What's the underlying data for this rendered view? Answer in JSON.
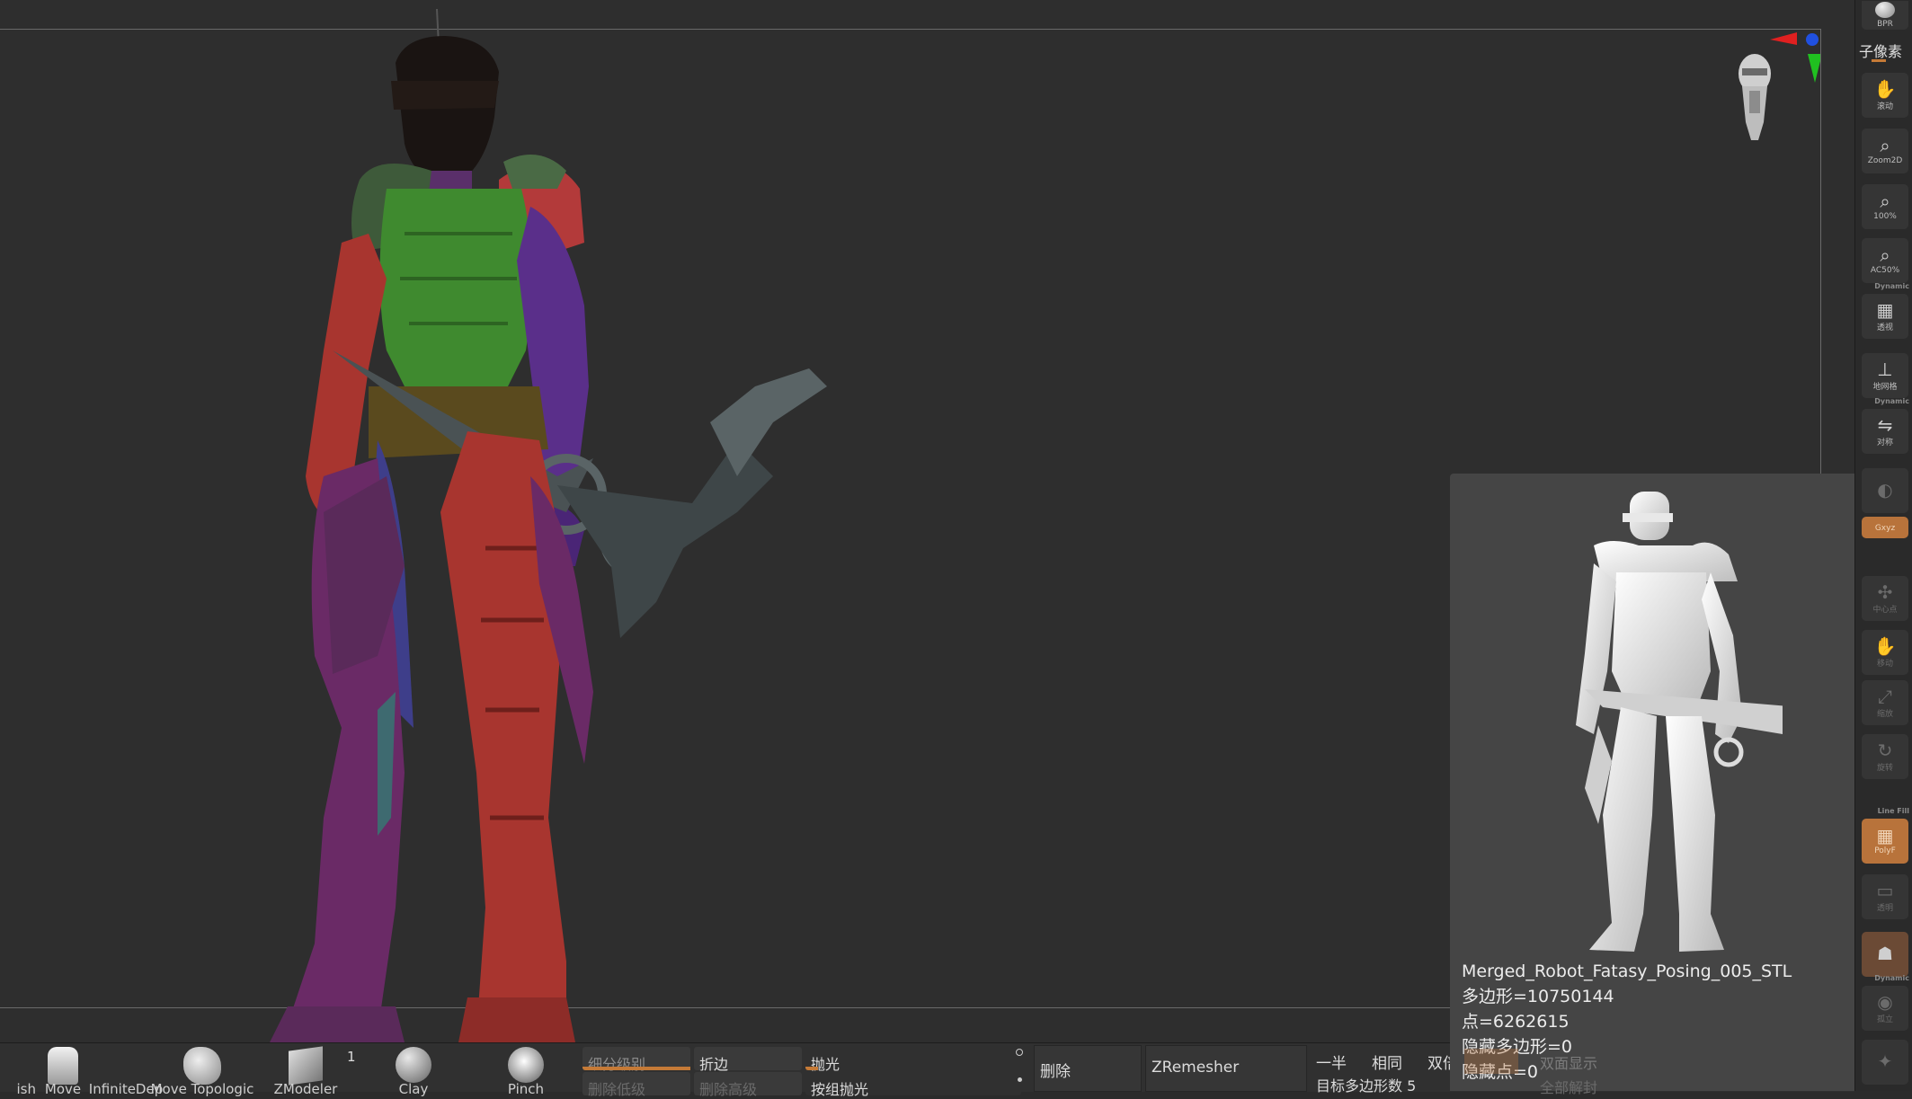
{
  "right_shelf": {
    "bpr": "BPR",
    "subpixel": "子像素",
    "items": [
      {
        "icon": "hand-move-icon",
        "label": "滚动"
      },
      {
        "icon": "zoom2d-icon",
        "label": "Zoom2D"
      },
      {
        "icon": "zoom-100-icon",
        "label": "100%"
      },
      {
        "icon": "zoom-ac50-icon",
        "label": "AC50%"
      },
      {
        "icon": "perspective-grid-icon",
        "label": "透视",
        "tag": "Dynamic"
      },
      {
        "icon": "floor-grid-icon",
        "label": "地网格"
      },
      {
        "icon": "symmetry-icon",
        "label": "对称",
        "tag": "Dynamic"
      },
      {
        "icon": "local-symmetry-icon",
        "label": ""
      },
      {
        "icon": "xyz-axis-icon",
        "label": "Gxyz"
      },
      {
        "icon": "center-icon",
        "label": "中心点"
      },
      {
        "icon": "move-icon",
        "label": "移动"
      },
      {
        "icon": "scale-icon",
        "label": "缩放"
      },
      {
        "icon": "rotate-icon",
        "label": "旋转"
      },
      {
        "icon": "polyframe-icon",
        "label": "PolyF",
        "tag": "Line Fill"
      },
      {
        "icon": "transparent-icon",
        "label": "透明"
      },
      {
        "icon": "ghost-icon",
        "label": ""
      },
      {
        "icon": "solo-icon",
        "label": "孤立",
        "tag": "Dynamic"
      },
      {
        "icon": "xpose-icon",
        "label": ""
      }
    ]
  },
  "bottom_tray": {
    "brushes": [
      {
        "name": "ish"
      },
      {
        "name": "Move"
      },
      {
        "name": "InfiniteDep"
      },
      {
        "name": "Move Topologic"
      },
      {
        "name": "ZModeler"
      },
      {
        "name": "Clay"
      },
      {
        "name": "Pinch"
      }
    ],
    "brush_counter": "1",
    "subdiv_level": "细分级别",
    "delete_lower": "删除低级",
    "crease": "折边",
    "delete_higher": "删除高级",
    "polish": "抛光",
    "polish_by_groups": "按组抛光",
    "delete": "删除",
    "zremesher": "ZRemesher",
    "half": "一半",
    "same": "相同",
    "double": "双倍",
    "target_poly_count": "目标多边形数 5",
    "double_sided": "双面显示",
    "all_groups": "全部解封"
  },
  "preview": {
    "model_name": "Merged_Robot_Fatasy_Posing_005_STL",
    "polygons": "多边形=10750144",
    "points": "点=6262615",
    "hidden_polys": "隐藏多边形=0",
    "hidden_points": "隐藏点=0"
  }
}
